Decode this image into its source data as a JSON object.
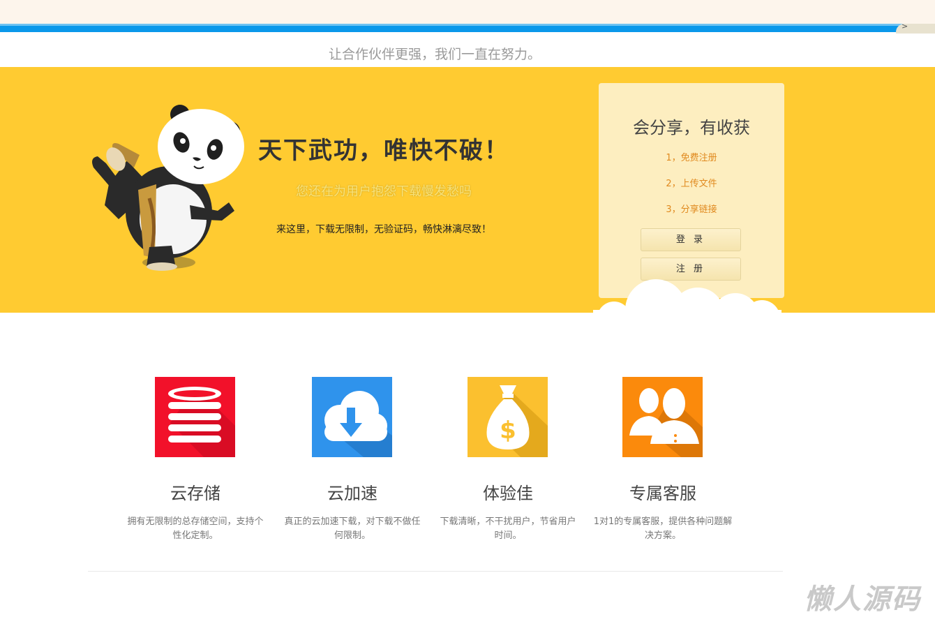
{
  "browser": {
    "corner_glyph": ">"
  },
  "slogan": "让合作伙伴更强，我们一直在努力。",
  "hero": {
    "title": "天下武功，唯快不破！",
    "subtitle": "您还在为用户抱怨下载慢发愁吗",
    "description": "来这里，下载无限制，无验证码，畅快淋漓尽致！",
    "background_color": "#ffcb31"
  },
  "card": {
    "title": "会分享，有收获",
    "steps": [
      "1，免费注册",
      "2，上传文件",
      "3，分享链接"
    ],
    "login_label": "登 录",
    "register_label": "注 册"
  },
  "features": [
    {
      "name": "云存储",
      "desc_line1": "拥有无限制的总存储空间，支持个",
      "desc_line2": "性化定制。",
      "icon": "database-icon",
      "color": "#f2112a"
    },
    {
      "name": "云加速",
      "desc_line1": "真正的云加速下载，对下载不做任",
      "desc_line2": "何限制。",
      "icon": "cloud-download-icon",
      "color": "#2f93ec"
    },
    {
      "name": "体验佳",
      "desc_line1": "下载清晰，不干扰用户，节省用户",
      "desc_line2": "时间。",
      "icon": "money-bag-icon",
      "color": "#fbc02f"
    },
    {
      "name": "专属客服",
      "desc_line1": "1对1的专属客服，提供各种问题解",
      "desc_line2": "决方案。",
      "icon": "users-icon",
      "color": "#fb8a0c"
    }
  ],
  "watermark": "懒人源码"
}
